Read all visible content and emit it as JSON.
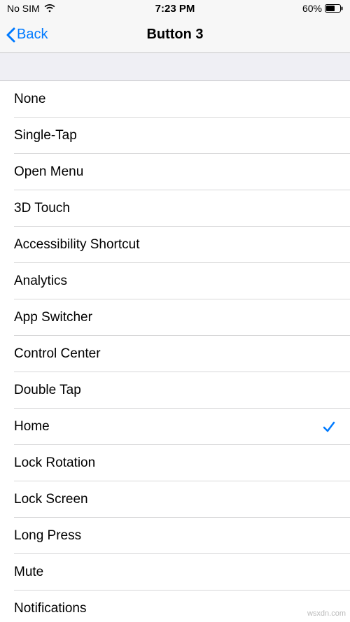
{
  "status": {
    "carrier": "No SIM",
    "time": "7:23 PM",
    "battery_percent": "60%"
  },
  "nav": {
    "back_label": "Back",
    "title": "Button 3"
  },
  "list": {
    "items": [
      {
        "label": "None",
        "selected": false
      },
      {
        "label": "Single-Tap",
        "selected": false
      },
      {
        "label": "Open Menu",
        "selected": false
      },
      {
        "label": "3D Touch",
        "selected": false
      },
      {
        "label": "Accessibility Shortcut",
        "selected": false
      },
      {
        "label": "Analytics",
        "selected": false
      },
      {
        "label": "App Switcher",
        "selected": false
      },
      {
        "label": "Control Center",
        "selected": false
      },
      {
        "label": "Double Tap",
        "selected": false
      },
      {
        "label": "Home",
        "selected": true
      },
      {
        "label": "Lock Rotation",
        "selected": false
      },
      {
        "label": "Lock Screen",
        "selected": false
      },
      {
        "label": "Long Press",
        "selected": false
      },
      {
        "label": "Mute",
        "selected": false
      },
      {
        "label": "Notifications",
        "selected": false
      }
    ]
  },
  "watermark": "wsxdn.com"
}
